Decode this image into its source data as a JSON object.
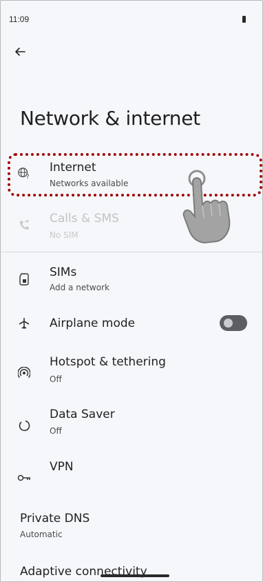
{
  "status": {
    "time": "11:09"
  },
  "header": {
    "title": "Network & internet"
  },
  "items": [
    {
      "title": "Internet",
      "subtitle": "Networks available",
      "icon": "globe-question-icon",
      "enabled": true
    },
    {
      "title": "Calls & SMS",
      "subtitle": "No SIM",
      "icon": "phone-forward-icon",
      "enabled": false
    },
    {
      "title": "SIMs",
      "subtitle": "Add a network",
      "icon": "sim-card-icon",
      "enabled": true
    },
    {
      "title": "Airplane mode",
      "subtitle": "",
      "icon": "airplane-icon",
      "enabled": true,
      "toggle_on": false
    },
    {
      "title": "Hotspot & tethering",
      "subtitle": "Off",
      "icon": "hotspot-icon",
      "enabled": true
    },
    {
      "title": "Data Saver",
      "subtitle": "Off",
      "icon": "data-saver-icon",
      "enabled": true
    },
    {
      "title": "VPN",
      "subtitle": "",
      "icon": "vpn-key-icon",
      "enabled": true
    }
  ],
  "private_dns": {
    "title": "Private DNS",
    "subtitle": "Automatic"
  },
  "adaptive": {
    "title": "Adaptive connectivity"
  },
  "colors": {
    "highlight": "#a00000",
    "background": "#f6f7fb",
    "toggle_off": "#5b5f64"
  }
}
